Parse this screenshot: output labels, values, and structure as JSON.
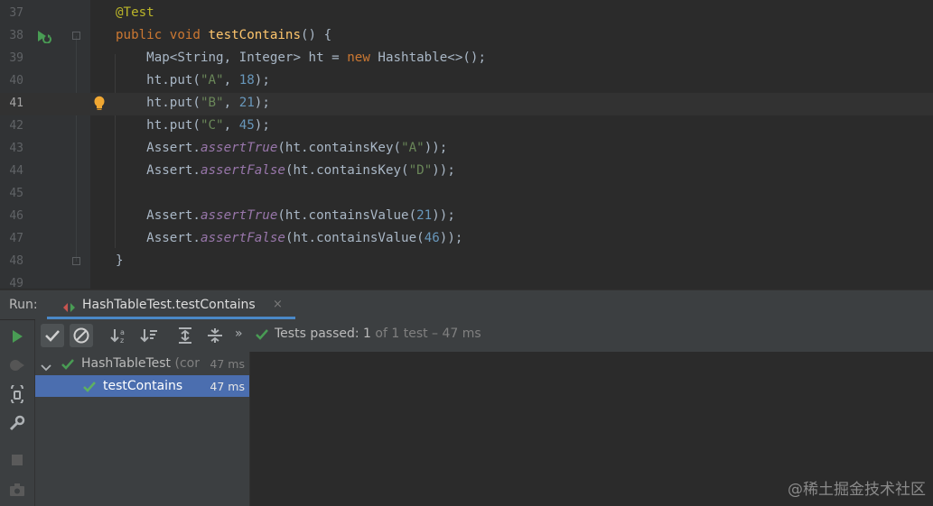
{
  "editor": {
    "lines": [
      {
        "num": "37"
      },
      {
        "num": "38"
      },
      {
        "num": "39"
      },
      {
        "num": "40"
      },
      {
        "num": "41"
      },
      {
        "num": "42"
      },
      {
        "num": "43"
      },
      {
        "num": "44"
      },
      {
        "num": "45"
      },
      {
        "num": "46"
      },
      {
        "num": "47"
      },
      {
        "num": "48"
      },
      {
        "num": "49"
      }
    ],
    "tokens": {
      "annotation": "@Test",
      "kw_public": "public",
      "kw_void": "void",
      "method_name": "testContains",
      "sig_rest": "() {",
      "l39_a": "Map<String, Integer> ht = ",
      "kw_new": "new",
      "l39_b": " Hashtable<>();",
      "put": "ht.put(",
      "str_a": "\"A\"",
      "str_b": "\"B\"",
      "str_c": "\"C\"",
      "str_d": "\"D\"",
      "comma": ", ",
      "num_18": "18",
      "num_21": "21",
      "num_45": "45",
      "num_46": "46",
      "close_semi": ");",
      "assert_prefix": "Assert.",
      "assert_true": "assertTrue",
      "assert_false": "assertFalse",
      "contains_key": "(ht.containsKey(",
      "contains_value": "(ht.containsValue(",
      "close_two": "));",
      "brace_close": "}"
    },
    "current_line": "41"
  },
  "run_panel": {
    "label": "Run:",
    "tab_title": "HashTableTest.testContains",
    "tab_close": "×",
    "more": "»",
    "status_prefix": "Tests passed: ",
    "status_count": "1",
    "status_rest": " of 1 test – 47 ms"
  },
  "test_tree": {
    "root": {
      "label": "HashTableTest",
      "sub": " (cor",
      "time": "47 ms"
    },
    "child": {
      "label": "testContains",
      "time": "47 ms"
    }
  },
  "watermark": "@稀土掘金技术社区",
  "colors": {
    "pass_green": "#499c54",
    "selection": "#4b6eaf",
    "bulb": "#f0a732"
  },
  "icons": [
    "run-gutter-icon",
    "bulb-icon",
    "rerun-icon",
    "check-icon",
    "stop-icon",
    "sort-alpha-icon",
    "sort-duration-icon",
    "expand-all-icon",
    "collapse-all-icon",
    "wrench-icon",
    "camera-icon",
    "debug-icon",
    "toggle-icon"
  ]
}
